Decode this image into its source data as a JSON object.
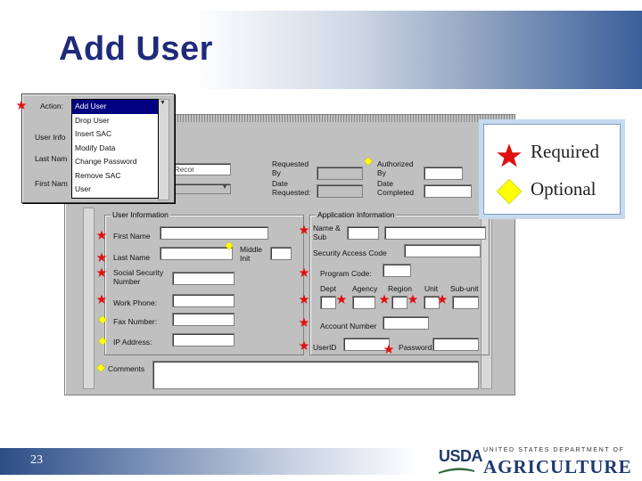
{
  "slide": {
    "title": "Add User",
    "number": "23"
  },
  "usda": {
    "acronym": "USDA",
    "line1": "UNITED STATES DEPARTMENT OF",
    "line2": "AGRICULTURE"
  },
  "legend": {
    "required": "Required",
    "optional": "Optional",
    "required_color": "#e01010",
    "optional_color": "#ffff00"
  },
  "action_panel": {
    "action_label": "Action:",
    "user_info_label": "User Info",
    "last_name_label": "Last Nam",
    "first_name_label": "First Nam",
    "menu_items": [
      "Add User",
      "Drop User",
      "Insert SAC",
      "Modify Data",
      "Change Password",
      "Remove SAC",
      "User"
    ],
    "selected_item": "Add User"
  },
  "form": {
    "dropdown_value": "py Recor",
    "requested_by": "Requested By",
    "date_requested": "Date Requested:",
    "authorized_by": "Authorized By",
    "date_completed": "Date Completed",
    "user_info": {
      "group_label": "User Information",
      "first_name": "First Name",
      "last_name": "Last Name",
      "middle_initial": "Middle Init",
      "ssn": "Social Security Number",
      "work_phone": "Work Phone:",
      "fax_number": "Fax Number:",
      "ip_address": "IP Address:"
    },
    "app_info": {
      "group_label": "Application Information",
      "name_sub": "Name & Sub",
      "security_access": "Security Access Code",
      "program_code": "Program Code:",
      "dept": "Dept",
      "agency": "Agency",
      "region": "Region",
      "unit": "Unit",
      "subunit": "Sub-unit",
      "account_number": "Account Number",
      "userid": "UserID",
      "password": "Password:"
    },
    "comments": "Comments"
  }
}
